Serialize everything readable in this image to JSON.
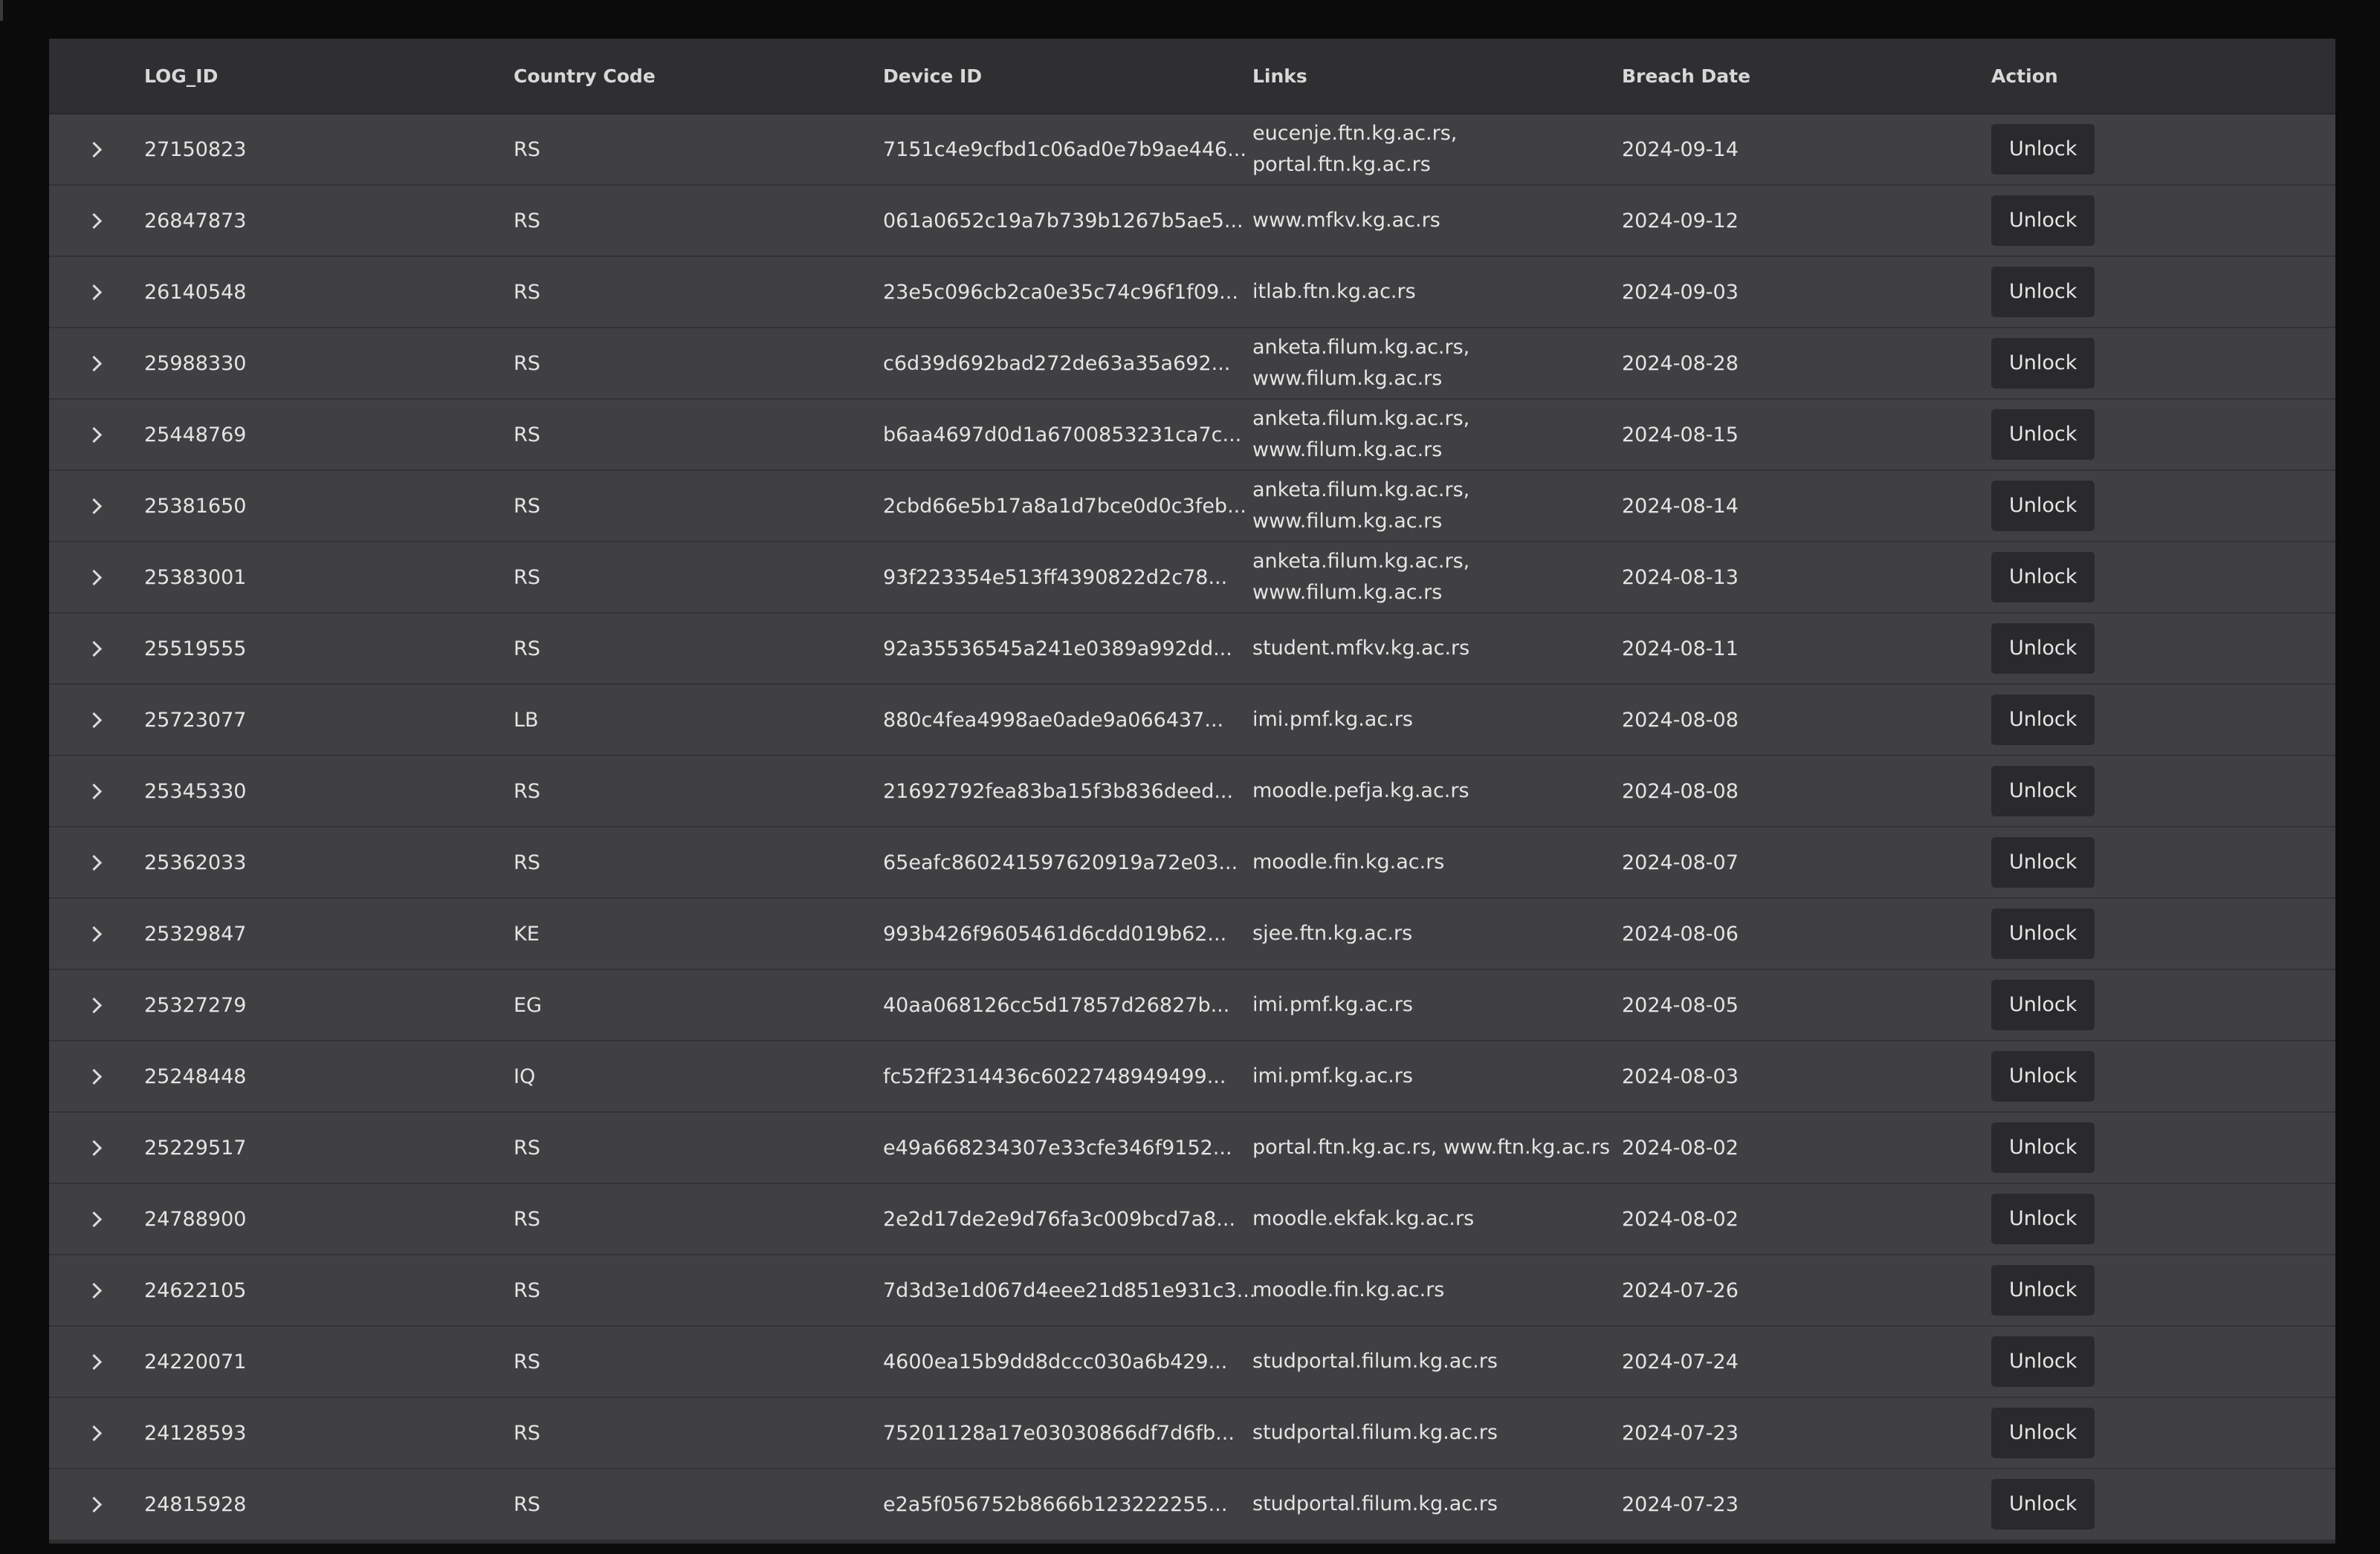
{
  "table": {
    "columns": {
      "log_id": "LOG_ID",
      "country_code": "Country Code",
      "device_id": "Device ID",
      "links": "Links",
      "breach_date": "Breach Date",
      "action": "Action"
    },
    "action_label": "Unlock",
    "rows": [
      {
        "log_id": "27150823",
        "country": "RS",
        "device": "7151c4e9cfbd1c06ad0e7b9ae446...",
        "links": [
          "eucenje.ftn.kg.ac.rs,",
          "portal.ftn.kg.ac.rs"
        ],
        "date": "2024-09-14"
      },
      {
        "log_id": "26847873",
        "country": "RS",
        "device": "061a0652c19a7b739b1267b5ae5...",
        "links": [
          "www.mfkv.kg.ac.rs"
        ],
        "date": "2024-09-12"
      },
      {
        "log_id": "26140548",
        "country": "RS",
        "device": "23e5c096cb2ca0e35c74c96f1f09...",
        "links": [
          "itlab.ftn.kg.ac.rs"
        ],
        "date": "2024-09-03"
      },
      {
        "log_id": "25988330",
        "country": "RS",
        "device": "c6d39d692bad272de63a35a692...",
        "links": [
          "anketa.filum.kg.ac.rs,",
          "www.filum.kg.ac.rs"
        ],
        "date": "2024-08-28"
      },
      {
        "log_id": "25448769",
        "country": "RS",
        "device": "b6aa4697d0d1a6700853231ca7c...",
        "links": [
          "anketa.filum.kg.ac.rs,",
          "www.filum.kg.ac.rs"
        ],
        "date": "2024-08-15"
      },
      {
        "log_id": "25381650",
        "country": "RS",
        "device": "2cbd66e5b17a8a1d7bce0d0c3feb...",
        "links": [
          "anketa.filum.kg.ac.rs,",
          "www.filum.kg.ac.rs"
        ],
        "date": "2024-08-14"
      },
      {
        "log_id": "25383001",
        "country": "RS",
        "device": "93f223354e513ff4390822d2c78...",
        "links": [
          "anketa.filum.kg.ac.rs,",
          "www.filum.kg.ac.rs"
        ],
        "date": "2024-08-13"
      },
      {
        "log_id": "25519555",
        "country": "RS",
        "device": "92a35536545a241e0389a992dd...",
        "links": [
          "student.mfkv.kg.ac.rs"
        ],
        "date": "2024-08-11"
      },
      {
        "log_id": "25723077",
        "country": "LB",
        "device": "880c4fea4998ae0ade9a066437...",
        "links": [
          "imi.pmf.kg.ac.rs"
        ],
        "date": "2024-08-08"
      },
      {
        "log_id": "25345330",
        "country": "RS",
        "device": "21692792fea83ba15f3b836deed...",
        "links": [
          "moodle.pefja.kg.ac.rs"
        ],
        "date": "2024-08-08"
      },
      {
        "log_id": "25362033",
        "country": "RS",
        "device": "65eafc860241597620919a72e03...",
        "links": [
          "moodle.fin.kg.ac.rs"
        ],
        "date": "2024-08-07"
      },
      {
        "log_id": "25329847",
        "country": "KE",
        "device": "993b426f9605461d6cdd019b62...",
        "links": [
          "sjee.ftn.kg.ac.rs"
        ],
        "date": "2024-08-06"
      },
      {
        "log_id": "25327279",
        "country": "EG",
        "device": "40aa068126cc5d17857d26827b...",
        "links": [
          "imi.pmf.kg.ac.rs"
        ],
        "date": "2024-08-05"
      },
      {
        "log_id": "25248448",
        "country": "IQ",
        "device": "fc52ff2314436c6022748949499...",
        "links": [
          "imi.pmf.kg.ac.rs"
        ],
        "date": "2024-08-03"
      },
      {
        "log_id": "25229517",
        "country": "RS",
        "device": "e49a668234307e33cfe346f9152...",
        "links": [
          "portal.ftn.kg.ac.rs, www.ftn.kg.ac.rs"
        ],
        "date": "2024-08-02"
      },
      {
        "log_id": "24788900",
        "country": "RS",
        "device": "2e2d17de2e9d76fa3c009bcd7a8...",
        "links": [
          "moodle.ekfak.kg.ac.rs"
        ],
        "date": "2024-08-02"
      },
      {
        "log_id": "24622105",
        "country": "RS",
        "device": "7d3d3e1d067d4eee21d851e931c3...",
        "links": [
          "moodle.fin.kg.ac.rs"
        ],
        "date": "2024-07-26"
      },
      {
        "log_id": "24220071",
        "country": "RS",
        "device": "4600ea15b9dd8dccc030a6b429...",
        "links": [
          "studportal.filum.kg.ac.rs"
        ],
        "date": "2024-07-24"
      },
      {
        "log_id": "24128593",
        "country": "RS",
        "device": "75201128a17e03030866df7d6fb...",
        "links": [
          "studportal.filum.kg.ac.rs"
        ],
        "date": "2024-07-23"
      },
      {
        "log_id": "24815928",
        "country": "RS",
        "device": "e2a5f056752b8666b123222255...",
        "links": [
          "studportal.filum.kg.ac.rs"
        ],
        "date": "2024-07-23"
      }
    ]
  }
}
